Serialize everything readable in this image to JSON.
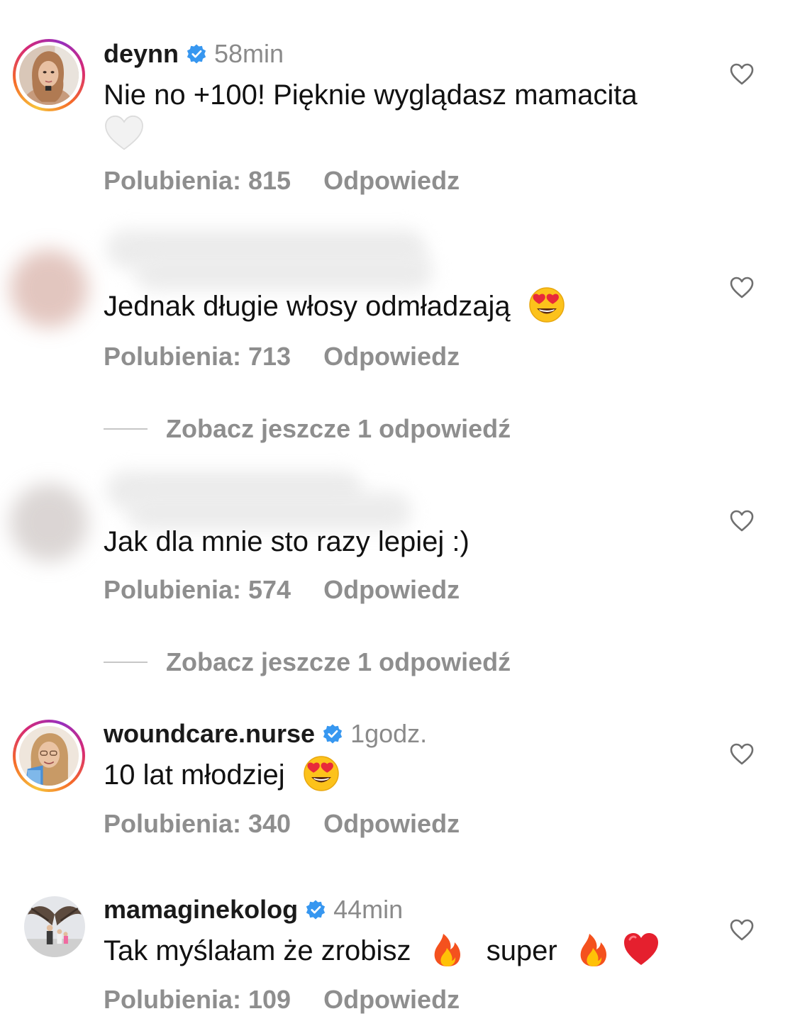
{
  "comments": [
    {
      "username": "deynn",
      "verified": true,
      "time": "58min",
      "text": "Nie no +100! Pięknie wyglądasz mamacita",
      "trailing_emoji": "white-heart",
      "likes": "Polubienia: 815",
      "reply": "Odpowiedz"
    },
    {
      "username": "",
      "verified": false,
      "time": "",
      "text": "Jednak długie włosy odmładzają",
      "trailing_emoji": "heart-eyes",
      "likes": "Polubienia: 713",
      "reply": "Odpowiedz",
      "view_replies": "Zobacz jeszcze 1 odpowiedź"
    },
    {
      "username": "",
      "verified": false,
      "time": "",
      "text": "Jak dla mnie sto razy lepiej :)",
      "likes": "Polubienia: 574",
      "reply": "Odpowiedz",
      "view_replies": "Zobacz jeszcze 1 odpowiedź"
    },
    {
      "username": "woundcare.nurse",
      "verified": true,
      "time": "1godz.",
      "text": "10 lat młodziej",
      "trailing_emoji": "heart-eyes",
      "likes": "Polubienia: 340",
      "reply": "Odpowiedz"
    },
    {
      "username": "mamaginekolog",
      "verified": true,
      "time": "44min",
      "text_part1": "Tak myślałam że zrobisz",
      "text_part2": "super",
      "emojis": [
        "fire",
        "fire",
        "red-heart"
      ],
      "likes": "Polubienia: 109",
      "reply": "Odpowiedz"
    }
  ],
  "colors": {
    "verified_blue": "#3797f0",
    "meta_gray": "#8e8e8e",
    "time_gray": "#8a8a8a"
  },
  "icons": {
    "like": "heart-outline-icon",
    "verified": "verified-badge-icon"
  }
}
